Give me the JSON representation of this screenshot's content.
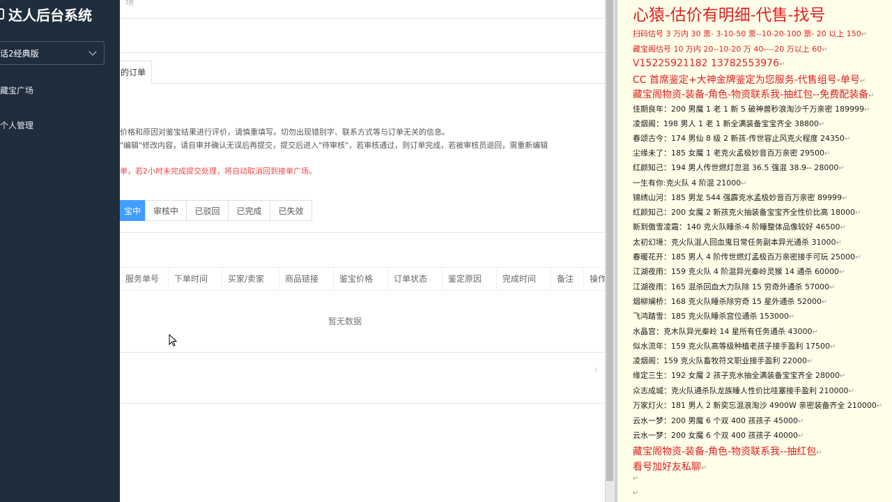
{
  "sidebar": {
    "logo_text": "达人后台系统",
    "version_select": "话2经典版",
    "items": [
      {
        "label": "藏宝广场"
      },
      {
        "label": "个人管理"
      }
    ]
  },
  "main": {
    "breadcrumb": "场",
    "tab_active": "的订单",
    "notices": [
      "价格和原因对鉴宝结果进行评价，请慎重填写。切勿出现错别字、联系方式等与订单无关的信息。",
      "\"编辑\"修改内容，请自审并确认无误后再提交，提交后进入\"待审核\"，若审核通过，则订单完成，若被审核员退回，需重新编辑",
      "单，若2小时未完成提交处理，将自动取消回到接单广场。"
    ],
    "status_tabs": [
      "宝中",
      "审核中",
      "已驳回",
      "已完成",
      "已失效"
    ],
    "columns": [
      "服务单号",
      "下单时间",
      "买家/卖家",
      "商品链接",
      "鉴宝价格",
      "订单状态",
      "鉴定原因",
      "完成时间",
      "备注",
      "操作"
    ],
    "empty_text": "暂无数据",
    "pager_prev": "‹"
  },
  "right_panel": {
    "title": "心猿-估价有明细-代售-找号",
    "lines": [
      {
        "text": "扫码估号 3 万内 30 票- 3-10-50 票--10-20-100 票- 20 以上 150",
        "style": "small-red"
      },
      {
        "text": "藏宝阁估号 10 万内 20--10-20 万 40----20 万以上 60",
        "style": "small-red"
      },
      {
        "text": "V15225921182   13782553976",
        "style": "phone"
      },
      {
        "text": "CC 首席鉴定+大神金牌鉴定为您服务-代售组号-单号",
        "style": "mid-red"
      },
      {
        "text": "藏宝阁物资-装备-角色-物资联系我-抽红包--免费配装备",
        "style": "mid-red"
      },
      {
        "text": "佳期良年：200 男魔 1 老 1 新 5 破神兽秒浪淘沙千万亲密 189999",
        "style": "black"
      },
      {
        "text": "凌烟阁：198 男人 1 老 1 新全满装备宝宝齐全 38800",
        "style": "black"
      },
      {
        "text": "春颂古今：174 男仙 8 级 2 新孩-传世容止风克火程度 24350",
        "style": "black"
      },
      {
        "text": "尘缘未了：185 女魔 1 老克火孟极妙音百万亲密 29500",
        "style": "black"
      },
      {
        "text": "红颜知己：194 男人传世燃灯忽混 36.5 强混 38.9-- 28000",
        "style": "black"
      },
      {
        "text": "一生有你:克火队 4 阶混 21000",
        "style": "black"
      },
      {
        "text": "锦绣山河：185 男龙 544 强霹克水孟极妙音百万亲密 89999",
        "style": "black"
      },
      {
        "text": "红颜知己：200 女魔 2 新孩克火抽装备宝宝齐全性价比高 18000",
        "style": "black"
      },
      {
        "text": "新到傲雪凌霜：140 克火队睡杀-4 阶睡整体品像较好 46500",
        "style": "black"
      },
      {
        "text": "太初幻境：克火队混人回血鬼日常任务副本异光通杀 31000",
        "style": "black"
      },
      {
        "text": "春暖花开：185 男人 4 阶传世燃灯孟极百万亲密接手可玩 25000",
        "style": "black"
      },
      {
        "text": "江湖夜雨：159 克火队 4 阶混异光秦岭灵猴 14 通杀 60000",
        "style": "black"
      },
      {
        "text": "江湖夜雨：165 混杀回血大力队除 15 穷奇外通杀 57000",
        "style": "black"
      },
      {
        "text": "烟柳斓桥：168 克火队睡杀除穷奇 15 星外通杀 52000",
        "style": "black"
      },
      {
        "text": "飞鸿踏雪：185 克火队睡杀宫位通杀 153000",
        "style": "black"
      },
      {
        "text": "水晶宫：克木队异光秦岭 14 星所有任务通杀 43000",
        "style": "black"
      },
      {
        "text": "似水流年：159 克火队高等级种植老孩子接手盈利 17500",
        "style": "black"
      },
      {
        "text": "凌烟阁：159 克火队畜牧符文职业接手盈利 22000",
        "style": "black"
      },
      {
        "text": "缘定三生：192 女魔 2 孩子克水抽全满装备宝宝齐全 28000",
        "style": "black"
      },
      {
        "text": "众志成城：克火队通杀队龙族睡人性价比哇塞接手盈利 210000",
        "style": "black"
      },
      {
        "text": "万家灯火：181 男人 2 新奕忘混浪淘沙 4900W 亲密装备齐全 210000",
        "style": "black"
      },
      {
        "text": "云水一梦：200 男魔 6 个双 400 孩孩子 45000",
        "style": "black"
      },
      {
        "text": "云水一梦：200 女魔 6 个双 400 孩孩子 40000",
        "style": "black"
      },
      {
        "text": "藏宝阁物资-装备-角色-物资联系我--抽红包",
        "style": "mid-red"
      },
      {
        "text": "看号加好友私聊",
        "style": "mid-red"
      }
    ],
    "return_mark": "↵"
  }
}
